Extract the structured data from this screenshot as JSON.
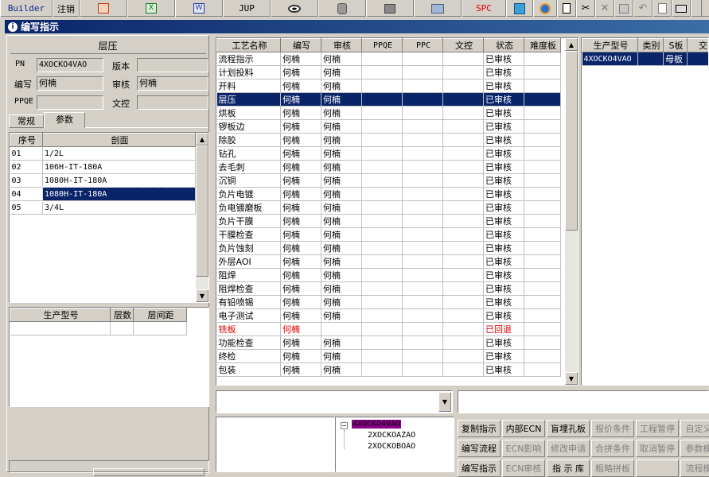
{
  "toolbar": {
    "builder_label": "Builder",
    "logout_label": "注销",
    "jup_label": "JUP",
    "spc_label": "SPC"
  },
  "window": {
    "title": "编写指示"
  },
  "left": {
    "section_title": "层压",
    "pn_label": "PN",
    "pn_value": "4XOCKO4VAO",
    "version_label": "版本",
    "version_value": "",
    "writer_label": "编写",
    "writer_value": "何楠",
    "reviewer_label": "审核",
    "reviewer_value": "何楠",
    "ppqe_label": "PPQE",
    "ppqe_value": "",
    "docctrl_label": "文控",
    "docctrl_value": "",
    "tabs": [
      "常规",
      "参数"
    ],
    "profile_table": {
      "headers": [
        "序号",
        "剖面"
      ],
      "rows": [
        [
          "01",
          "1/2L"
        ],
        [
          "02",
          "106H-IT-180A"
        ],
        [
          "03",
          "1080H-IT-180A"
        ],
        [
          "04",
          "1080H-IT-180A"
        ],
        [
          "05",
          "3/4L"
        ]
      ],
      "selected_index": 3
    },
    "model_table": {
      "headers": [
        "生产型号",
        "层数",
        "层间距"
      ]
    }
  },
  "process_table": {
    "headers": [
      "工艺名称",
      "编写",
      "审核",
      "PPQE",
      "PPC",
      "文控",
      "状态",
      "难度板"
    ],
    "rows": [
      [
        "流程指示",
        "何楠",
        "何楠",
        "",
        "",
        "",
        "已审核",
        ""
      ],
      [
        "计划投料",
        "何楠",
        "何楠",
        "",
        "",
        "",
        "已审核",
        ""
      ],
      [
        "开料",
        "何楠",
        "何楠",
        "",
        "",
        "",
        "已审核",
        ""
      ],
      [
        "层压",
        "何楠",
        "何楠",
        "",
        "",
        "",
        "已审核",
        ""
      ],
      [
        "烘板",
        "何楠",
        "何楠",
        "",
        "",
        "",
        "已审核",
        ""
      ],
      [
        "锣板边",
        "何楠",
        "何楠",
        "",
        "",
        "",
        "已审核",
        ""
      ],
      [
        "除胶",
        "何楠",
        "何楠",
        "",
        "",
        "",
        "已审核",
        ""
      ],
      [
        "钻孔",
        "何楠",
        "何楠",
        "",
        "",
        "",
        "已审核",
        ""
      ],
      [
        "去毛刺",
        "何楠",
        "何楠",
        "",
        "",
        "",
        "已审核",
        ""
      ],
      [
        "沉铜",
        "何楠",
        "何楠",
        "",
        "",
        "",
        "已审核",
        ""
      ],
      [
        "负片电镀",
        "何楠",
        "何楠",
        "",
        "",
        "",
        "已审核",
        ""
      ],
      [
        "负电镀磨板",
        "何楠",
        "何楠",
        "",
        "",
        "",
        "已审核",
        ""
      ],
      [
        "负片干膜",
        "何楠",
        "何楠",
        "",
        "",
        "",
        "已审核",
        ""
      ],
      [
        "干膜检查",
        "何楠",
        "何楠",
        "",
        "",
        "",
        "已审核",
        ""
      ],
      [
        "负片蚀刻",
        "何楠",
        "何楠",
        "",
        "",
        "",
        "已审核",
        ""
      ],
      [
        "外层AOI",
        "何楠",
        "何楠",
        "",
        "",
        "",
        "已审核",
        ""
      ],
      [
        "阻焊",
        "何楠",
        "何楠",
        "",
        "",
        "",
        "已审核",
        ""
      ],
      [
        "阻焊检查",
        "何楠",
        "何楠",
        "",
        "",
        "",
        "已审核",
        ""
      ],
      [
        "有铅喷锡",
        "何楠",
        "何楠",
        "",
        "",
        "",
        "已审核",
        ""
      ],
      [
        "电子测试",
        "何楠",
        "何楠",
        "",
        "",
        "",
        "已审核",
        ""
      ],
      [
        "铣板",
        "何楠",
        "",
        "",
        "",
        "",
        "已回退",
        ""
      ],
      [
        "功能检查",
        "何楠",
        "何楠",
        "",
        "",
        "",
        "已审核",
        ""
      ],
      [
        "终检",
        "何楠",
        "何楠",
        "",
        "",
        "",
        "已审核",
        ""
      ],
      [
        "包装",
        "何楠",
        "何楠",
        "",
        "",
        "",
        "已审核",
        ""
      ]
    ],
    "selected_index": 3,
    "rejected_index": 20
  },
  "right_table": {
    "headers": [
      "生产型号",
      "类别",
      "S板",
      "交"
    ],
    "rows": [
      [
        "4XOCKO4VAO",
        "",
        "母板",
        ""
      ]
    ]
  },
  "tree": {
    "root": "4XOCKO4VAO",
    "children": [
      "2XOCKOAZAO",
      "2XOCKOBOAO"
    ]
  },
  "buttons": {
    "row1": [
      "复制指示",
      "内部ECN",
      "盲埋孔板",
      "报价条件",
      "工程暂停",
      "自定义"
    ],
    "row2": [
      "编写流程",
      "ECN影响",
      "修改申请",
      "合拼条件",
      "取消暂停",
      "参数模"
    ],
    "row3": [
      "编写指示",
      "ECN审核",
      "指 示 库",
      "粗略拼板",
      "",
      "流程模"
    ]
  },
  "colors": {
    "selection": "#0a246a",
    "rejected": "#e00000",
    "tree_root_bg": "#8b008b"
  }
}
